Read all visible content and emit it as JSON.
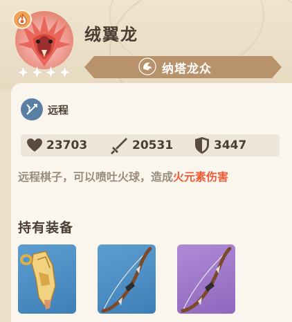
{
  "character": {
    "name": "绒翼龙",
    "stars": 4,
    "element_icon": "pyro-element-icon",
    "faction": {
      "label": "纳塔龙众",
      "icon": "natlan-dragon-icon"
    }
  },
  "role": {
    "label": "远程",
    "icon": "ranged-role-icon"
  },
  "stats": {
    "hp": "23703",
    "atk": "20531",
    "def": "3447"
  },
  "description": {
    "normal": "远程棋子，可以喷吐火球，造成",
    "highlight": "火元素伤害"
  },
  "equipment": {
    "title": "持有装备",
    "items": [
      {
        "icon": "horn-relic-icon",
        "rarity": "blue"
      },
      {
        "icon": "bow-icon",
        "rarity": "blue"
      },
      {
        "icon": "bow-icon",
        "rarity": "purple"
      }
    ]
  },
  "colors": {
    "highlight": "#ef5a35",
    "text": "#4a3d33",
    "faction_banner": "#b8926a"
  }
}
